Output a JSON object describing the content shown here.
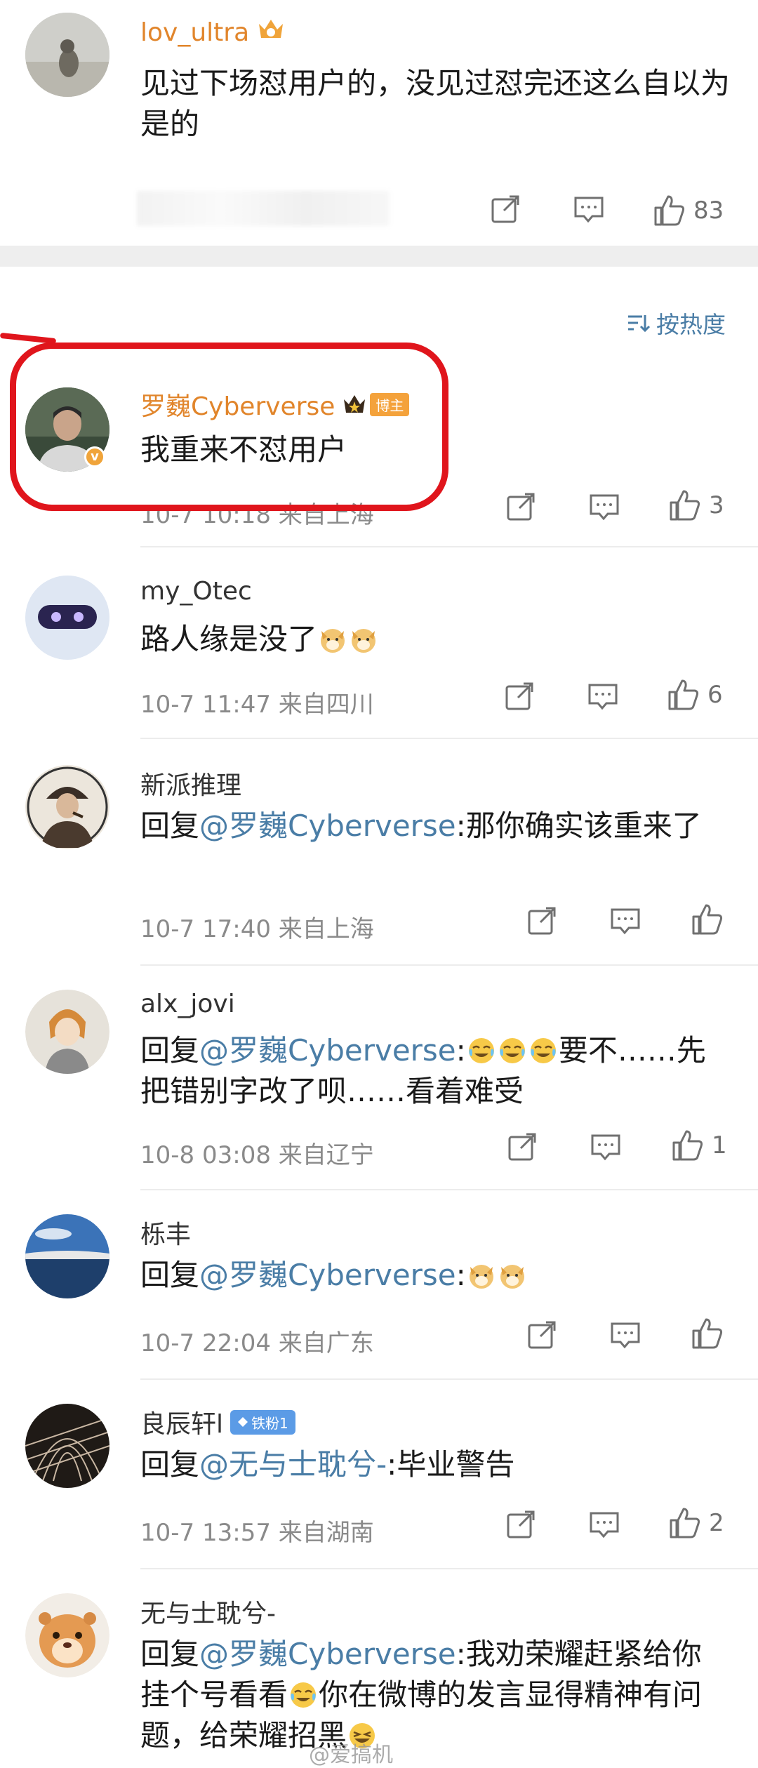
{
  "colors": {
    "accent_blue": "#4a7da6",
    "gold_name": "#e1852b",
    "highlight_red": "#e0151c",
    "meta_gray": "#8a8a8a"
  },
  "top_comment": {
    "username": "lov_ultra",
    "text": "见过下场怼用户的，没见过怼完还这么自以为是的",
    "like_count": "83"
  },
  "sort": {
    "label": "按热度",
    "icon": "sort-icon"
  },
  "comments": [
    {
      "username": "罗巍Cyberverse",
      "badge": "博主",
      "text": "我重来不怼用户",
      "meta": "10-7 10:18 来自上海",
      "like_count": "3"
    },
    {
      "username": "my_Otec",
      "text": "路人缘是没了",
      "meta": "10-7 11:47 来自四川",
      "like_count": "6"
    },
    {
      "username": "新派推理",
      "reply_prefix": "回复",
      "mention": "@罗巍Cyberverse",
      "text": ":那你确实该重来了",
      "meta": "10-7 17:40 来自上海",
      "like_count": ""
    },
    {
      "username": "alx_jovi",
      "reply_prefix": "回复",
      "mention": "@罗巍Cyberverse",
      "text_before": ":",
      "text": "要不……先把错别字改了呗……看着难受",
      "meta": "10-8 03:08 来自辽宁",
      "like_count": "1"
    },
    {
      "username": "栎丰",
      "reply_prefix": "回复",
      "mention": "@罗巍Cyberverse",
      "text": ":",
      "meta": "10-7 22:04 来自广东",
      "like_count": ""
    },
    {
      "username": "良辰轩l",
      "badge": "铁粉1",
      "reply_prefix": "回复",
      "mention": "@无与士耽兮-",
      "text": ":毕业警告",
      "meta": "10-7 13:57 来自湖南",
      "like_count": "2"
    },
    {
      "username": "无与士耽兮-",
      "reply_prefix": "回复",
      "mention": "@罗巍Cyberverse",
      "text_a": ":我劝荣耀赶紧给你挂个号看看",
      "text_b": "你在微博的发言显得精神有问题，给荣耀招黑",
      "meta": "",
      "like_count": ""
    }
  ],
  "watermark": "@爱搞机"
}
